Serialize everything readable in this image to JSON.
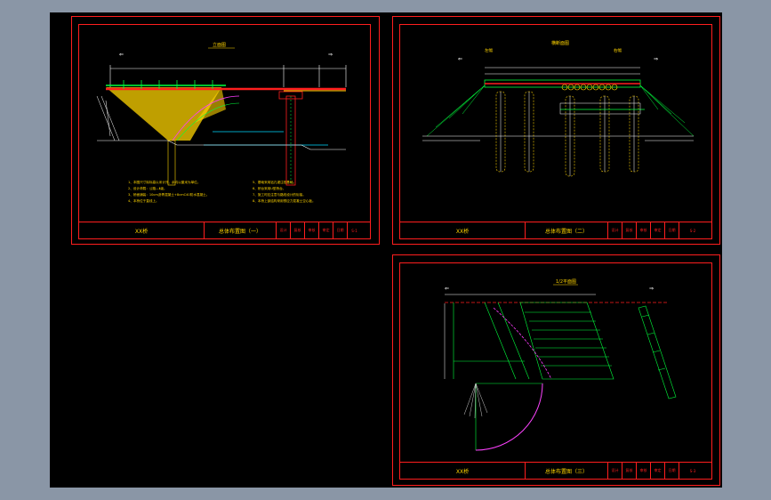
{
  "sheets": [
    {
      "id": "sheet1",
      "drawing_title": "立面图",
      "titlebar": {
        "project": "XX桥",
        "sheet_name": "总体布置图（一）",
        "fields": [
          "设计",
          "复核",
          "审核",
          "审定",
          "日期",
          "图号"
        ],
        "sheet_no": "S-1"
      },
      "notes": [
        "1、本图尺寸除标高以米计外，余均以厘米为单位。",
        "2、设计荷载：公路—Ⅱ级。",
        "3、桥面铺装：10cm沥青混凝土+8cmC40防水混凝土。",
        "4、本桥位于直线上。",
        "5、基础采用钻孔灌注桩基础。",
        "6、桥台采用U型桥台。",
        "7、施工时应注意与路线设计的衔接。",
        "8、本桥上部结构采用预应力混凝土空心板。"
      ]
    },
    {
      "id": "sheet2",
      "drawing_title": "横断面图",
      "labels_left": "左幅",
      "labels_right": "右幅",
      "titlebar": {
        "project": "XX桥",
        "sheet_name": "总体布置图（二）",
        "fields": [
          "设计",
          "复核",
          "审核",
          "审定",
          "日期",
          "图号"
        ],
        "sheet_no": "S-2"
      }
    },
    {
      "id": "sheet3",
      "drawing_title": "1/2平面图",
      "titlebar": {
        "project": "XX桥",
        "sheet_name": "总体布置图（三）",
        "fields": [
          "设计",
          "复核",
          "审核",
          "审定",
          "日期",
          "图号"
        ],
        "sheet_no": "S-3"
      }
    }
  ],
  "colors": {
    "background": "#000000",
    "frame": "#ff1e1e",
    "green": "#00ff3c",
    "yellow": "#ffd400",
    "cyan": "#00d8ff",
    "magenta": "#ff3cff",
    "white": "#ffffff",
    "desktop": "#8a96a6"
  }
}
